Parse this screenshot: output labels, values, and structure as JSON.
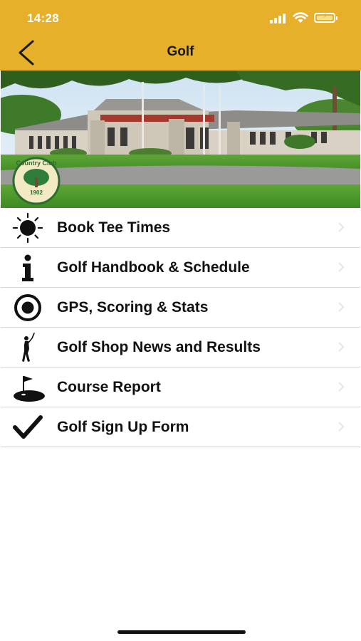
{
  "status": {
    "time": "14:28"
  },
  "nav": {
    "title": "Golf",
    "back_icon": "chevron-left-icon"
  },
  "hero": {
    "logo_top_text": "Country Club",
    "logo_year": "1902"
  },
  "menu": {
    "items": [
      {
        "label": "Book Tee Times",
        "icon": "sun-icon"
      },
      {
        "label": "Golf Handbook & Schedule",
        "icon": "info-icon"
      },
      {
        "label": "GPS, Scoring & Stats",
        "icon": "target-icon"
      },
      {
        "label": "Golf Shop News and Results",
        "icon": "golfer-icon"
      },
      {
        "label": "Course Report",
        "icon": "golf-flag-icon"
      },
      {
        "label": "Golf Sign Up Form",
        "icon": "checkmark-icon"
      }
    ]
  },
  "colors": {
    "header": "#e7b02a"
  }
}
